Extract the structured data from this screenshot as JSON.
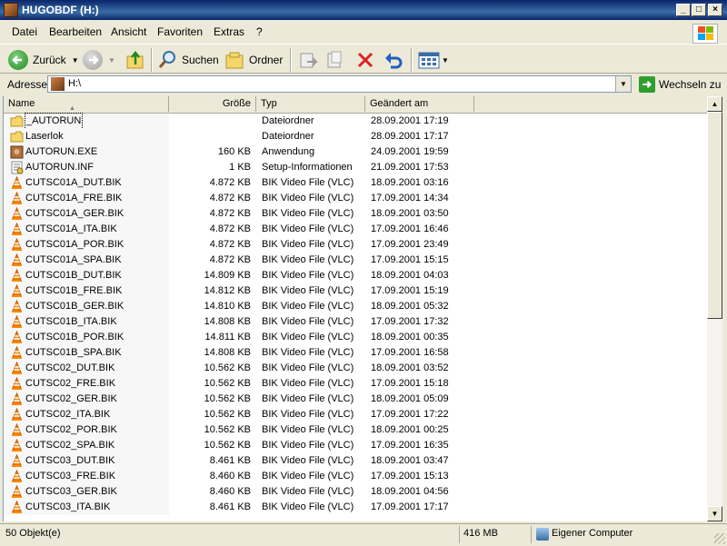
{
  "window": {
    "title": "HUGOBDF (H:)"
  },
  "menubar": {
    "items": [
      "Datei",
      "Bearbeiten",
      "Ansicht",
      "Favoriten",
      "Extras",
      "?"
    ]
  },
  "toolbar": {
    "back_label": "Zurück",
    "search_label": "Suchen",
    "folders_label": "Ordner"
  },
  "address": {
    "label": "Adresse",
    "value": "H:\\",
    "go_label": "Wechseln zu"
  },
  "columns": {
    "name": "Name",
    "size": "Größe",
    "type": "Typ",
    "date": "Geändert am"
  },
  "files": [
    {
      "name": "_AUTORUN",
      "size": "",
      "type": "Dateiordner",
      "date": "28.09.2001 17:19",
      "icon": "folder-icon"
    },
    {
      "name": "Laserlok",
      "size": "",
      "type": "Dateiordner",
      "date": "28.09.2001 17:17",
      "icon": "folder-icon"
    },
    {
      "name": "AUTORUN.EXE",
      "size": "160 KB",
      "type": "Anwendung",
      "date": "24.09.2001 19:59",
      "icon": "application-icon"
    },
    {
      "name": "AUTORUN.INF",
      "size": "1 KB",
      "type": "Setup-Informationen",
      "date": "21.09.2001 17:53",
      "icon": "setup-info-icon"
    },
    {
      "name": "CUTSC01A_DUT.BIK",
      "size": "4.872 KB",
      "type": "BIK Video File (VLC)",
      "date": "18.09.2001 03:16",
      "icon": "vlc-cone-icon"
    },
    {
      "name": "CUTSC01A_FRE.BIK",
      "size": "4.872 KB",
      "type": "BIK Video File (VLC)",
      "date": "17.09.2001 14:34",
      "icon": "vlc-cone-icon"
    },
    {
      "name": "CUTSC01A_GER.BIK",
      "size": "4.872 KB",
      "type": "BIK Video File (VLC)",
      "date": "18.09.2001 03:50",
      "icon": "vlc-cone-icon"
    },
    {
      "name": "CUTSC01A_ITA.BIK",
      "size": "4.872 KB",
      "type": "BIK Video File (VLC)",
      "date": "17.09.2001 16:46",
      "icon": "vlc-cone-icon"
    },
    {
      "name": "CUTSC01A_POR.BIK",
      "size": "4.872 KB",
      "type": "BIK Video File (VLC)",
      "date": "17.09.2001 23:49",
      "icon": "vlc-cone-icon"
    },
    {
      "name": "CUTSC01A_SPA.BIK",
      "size": "4.872 KB",
      "type": "BIK Video File (VLC)",
      "date": "17.09.2001 15:15",
      "icon": "vlc-cone-icon"
    },
    {
      "name": "CUTSC01B_DUT.BIK",
      "size": "14.809 KB",
      "type": "BIK Video File (VLC)",
      "date": "18.09.2001 04:03",
      "icon": "vlc-cone-icon"
    },
    {
      "name": "CUTSC01B_FRE.BIK",
      "size": "14.812 KB",
      "type": "BIK Video File (VLC)",
      "date": "17.09.2001 15:19",
      "icon": "vlc-cone-icon"
    },
    {
      "name": "CUTSC01B_GER.BIK",
      "size": "14.810 KB",
      "type": "BIK Video File (VLC)",
      "date": "18.09.2001 05:32",
      "icon": "vlc-cone-icon"
    },
    {
      "name": "CUTSC01B_ITA.BIK",
      "size": "14.808 KB",
      "type": "BIK Video File (VLC)",
      "date": "17.09.2001 17:32",
      "icon": "vlc-cone-icon"
    },
    {
      "name": "CUTSC01B_POR.BIK",
      "size": "14.811 KB",
      "type": "BIK Video File (VLC)",
      "date": "18.09.2001 00:35",
      "icon": "vlc-cone-icon"
    },
    {
      "name": "CUTSC01B_SPA.BIK",
      "size": "14.808 KB",
      "type": "BIK Video File (VLC)",
      "date": "17.09.2001 16:58",
      "icon": "vlc-cone-icon"
    },
    {
      "name": "CUTSC02_DUT.BIK",
      "size": "10.562 KB",
      "type": "BIK Video File (VLC)",
      "date": "18.09.2001 03:52",
      "icon": "vlc-cone-icon"
    },
    {
      "name": "CUTSC02_FRE.BIK",
      "size": "10.562 KB",
      "type": "BIK Video File (VLC)",
      "date": "17.09.2001 15:18",
      "icon": "vlc-cone-icon"
    },
    {
      "name": "CUTSC02_GER.BIK",
      "size": "10.562 KB",
      "type": "BIK Video File (VLC)",
      "date": "18.09.2001 05:09",
      "icon": "vlc-cone-icon"
    },
    {
      "name": "CUTSC02_ITA.BIK",
      "size": "10.562 KB",
      "type": "BIK Video File (VLC)",
      "date": "17.09.2001 17:22",
      "icon": "vlc-cone-icon"
    },
    {
      "name": "CUTSC02_POR.BIK",
      "size": "10.562 KB",
      "type": "BIK Video File (VLC)",
      "date": "18.09.2001 00:25",
      "icon": "vlc-cone-icon"
    },
    {
      "name": "CUTSC02_SPA.BIK",
      "size": "10.562 KB",
      "type": "BIK Video File (VLC)",
      "date": "17.09.2001 16:35",
      "icon": "vlc-cone-icon"
    },
    {
      "name": "CUTSC03_DUT.BIK",
      "size": "8.461 KB",
      "type": "BIK Video File (VLC)",
      "date": "18.09.2001 03:47",
      "icon": "vlc-cone-icon"
    },
    {
      "name": "CUTSC03_FRE.BIK",
      "size": "8.460 KB",
      "type": "BIK Video File (VLC)",
      "date": "17.09.2001 15:13",
      "icon": "vlc-cone-icon"
    },
    {
      "name": "CUTSC03_GER.BIK",
      "size": "8.460 KB",
      "type": "BIK Video File (VLC)",
      "date": "18.09.2001 04:56",
      "icon": "vlc-cone-icon"
    },
    {
      "name": "CUTSC03_ITA.BIK",
      "size": "8.461 KB",
      "type": "BIK Video File (VLC)",
      "date": "17.09.2001 17:17",
      "icon": "vlc-cone-icon"
    }
  ],
  "statusbar": {
    "count": "50 Objekt(e)",
    "size": "416 MB",
    "location": "Eigener Computer"
  },
  "colors": {
    "titlebar": "#0a246a",
    "vlc_orange": "#ff8a00",
    "folder_yellow": "#f5d66a"
  }
}
